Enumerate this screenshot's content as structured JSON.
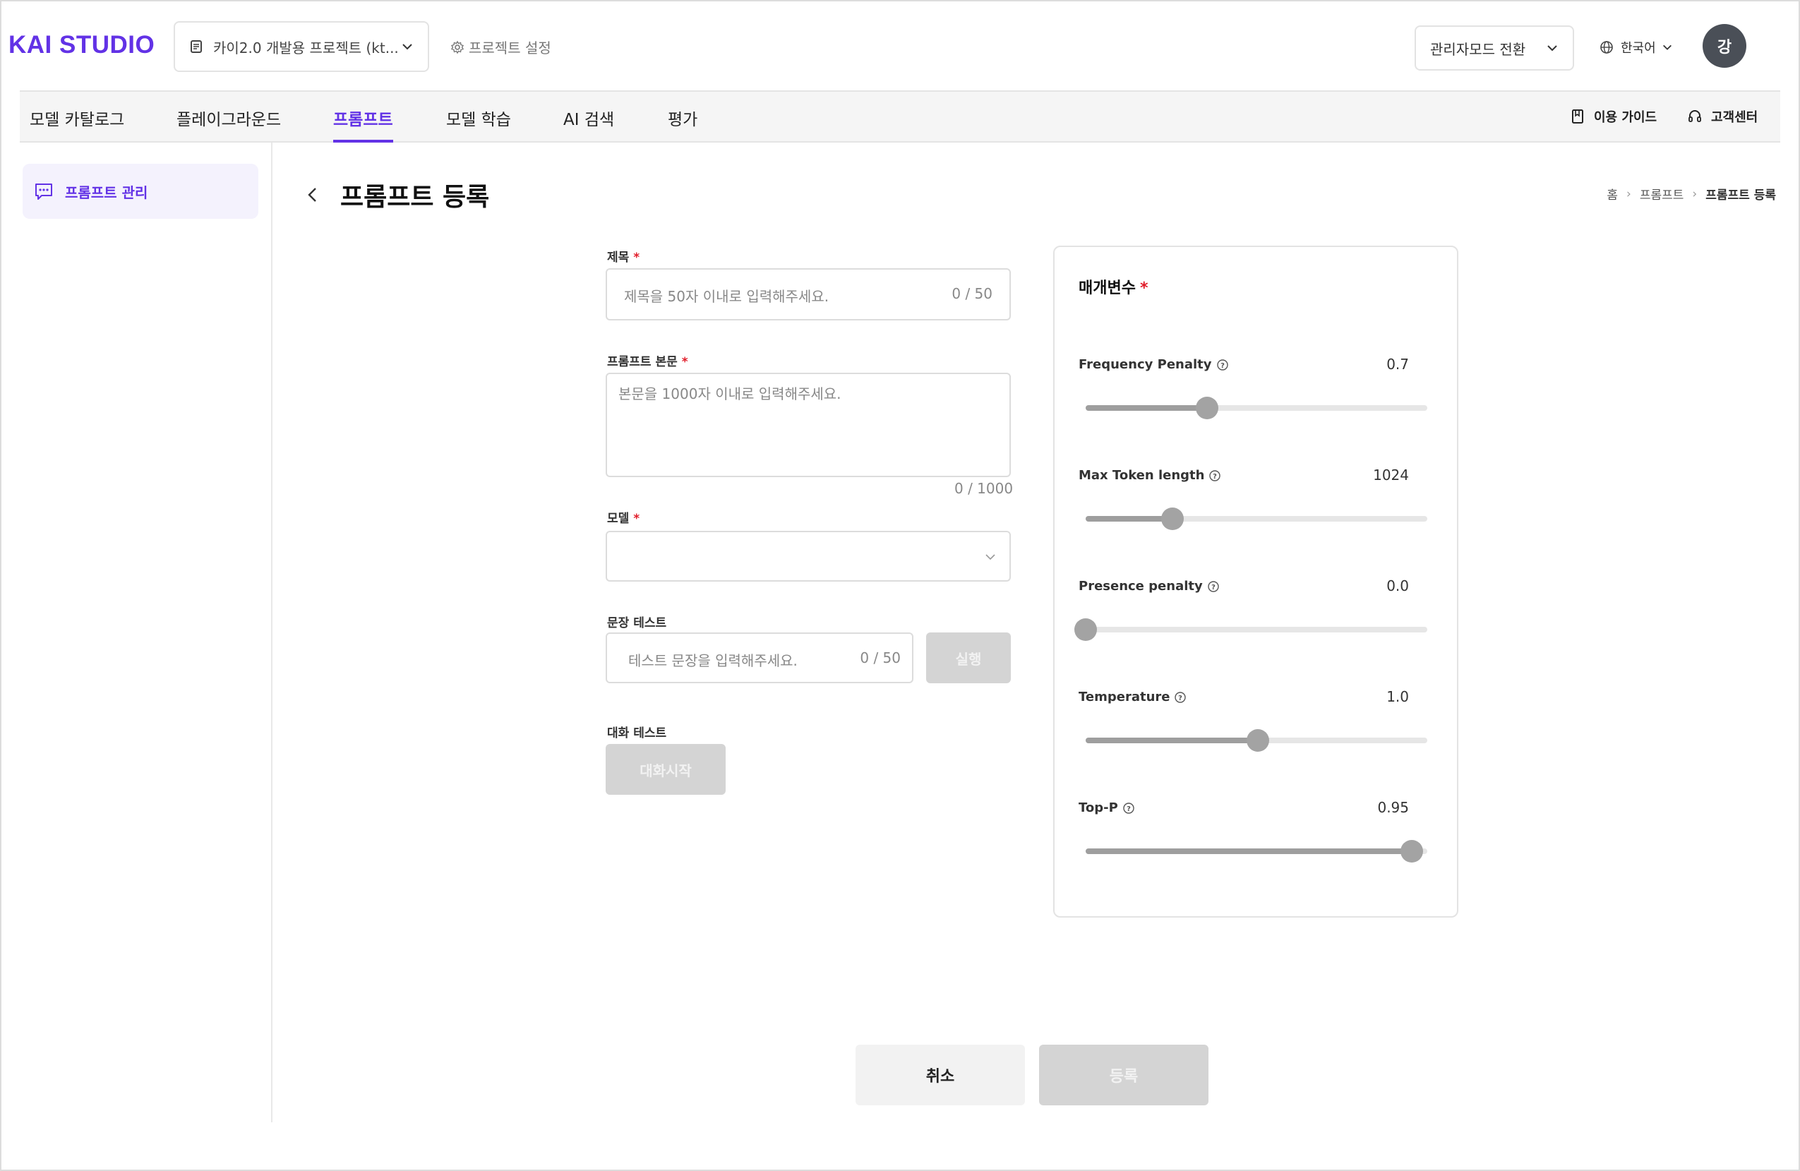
{
  "header": {
    "logo": "KAI STUDIO",
    "project": "카이2.0 개발용 프로젝트 (kt...",
    "project_settings": "프로젝트 설정",
    "admin_switch": "관리자모드 전환",
    "language": "한국어",
    "avatar_initial": "강"
  },
  "nav": {
    "tabs": [
      {
        "label": "모델 카탈로그"
      },
      {
        "label": "플레이그라운드"
      },
      {
        "label": "프롬프트"
      },
      {
        "label": "모델 학습"
      },
      {
        "label": "AI 검색"
      },
      {
        "label": "평가"
      }
    ],
    "active_tab": "프롬프트",
    "guide": "이용 가이드",
    "support": "고객센터"
  },
  "sidebar": {
    "items": [
      {
        "label": "프롬프트 관리"
      }
    ]
  },
  "page": {
    "title": "프롬프트 등록",
    "breadcrumb": [
      "홈",
      "프롬프트",
      "프롬프트 등록"
    ]
  },
  "form": {
    "title_label": "제목",
    "title_placeholder": "제목을 50자 이내로 입력해주세요.",
    "title_counter": "0 / 50",
    "body_label": "프롬프트 본문",
    "body_placeholder": "본문을 1000자 이내로 입력해주세요.",
    "body_counter": "0 / 1000",
    "model_label": "모델",
    "model_value": "",
    "sentence_test_label": "문장 테스트",
    "sentence_test_placeholder": "테스트 문장을 입력해주세요.",
    "sentence_test_counter": "0 / 50",
    "run_button": "실행",
    "chat_test_label": "대화 테스트",
    "chat_start_button": "대화시작",
    "required_mark": "*"
  },
  "params": {
    "title": "매개변수",
    "items": [
      {
        "label": "Frequency Penalty",
        "value": "0.7",
        "fraction": 0.355
      },
      {
        "label": "Max Token length",
        "value": "1024",
        "fraction": 0.255
      },
      {
        "label": "Presence penalty",
        "value": "0.0",
        "fraction": 0.0
      },
      {
        "label": "Temperature",
        "value": "1.0",
        "fraction": 0.505
      },
      {
        "label": "Top-P",
        "value": "0.95",
        "fraction": 0.955
      }
    ]
  },
  "actions": {
    "cancel": "취소",
    "register": "등록"
  },
  "colors": {
    "accent": "#6232e6",
    "required": "#e11d2a",
    "disabled": "#d4d4d4"
  }
}
